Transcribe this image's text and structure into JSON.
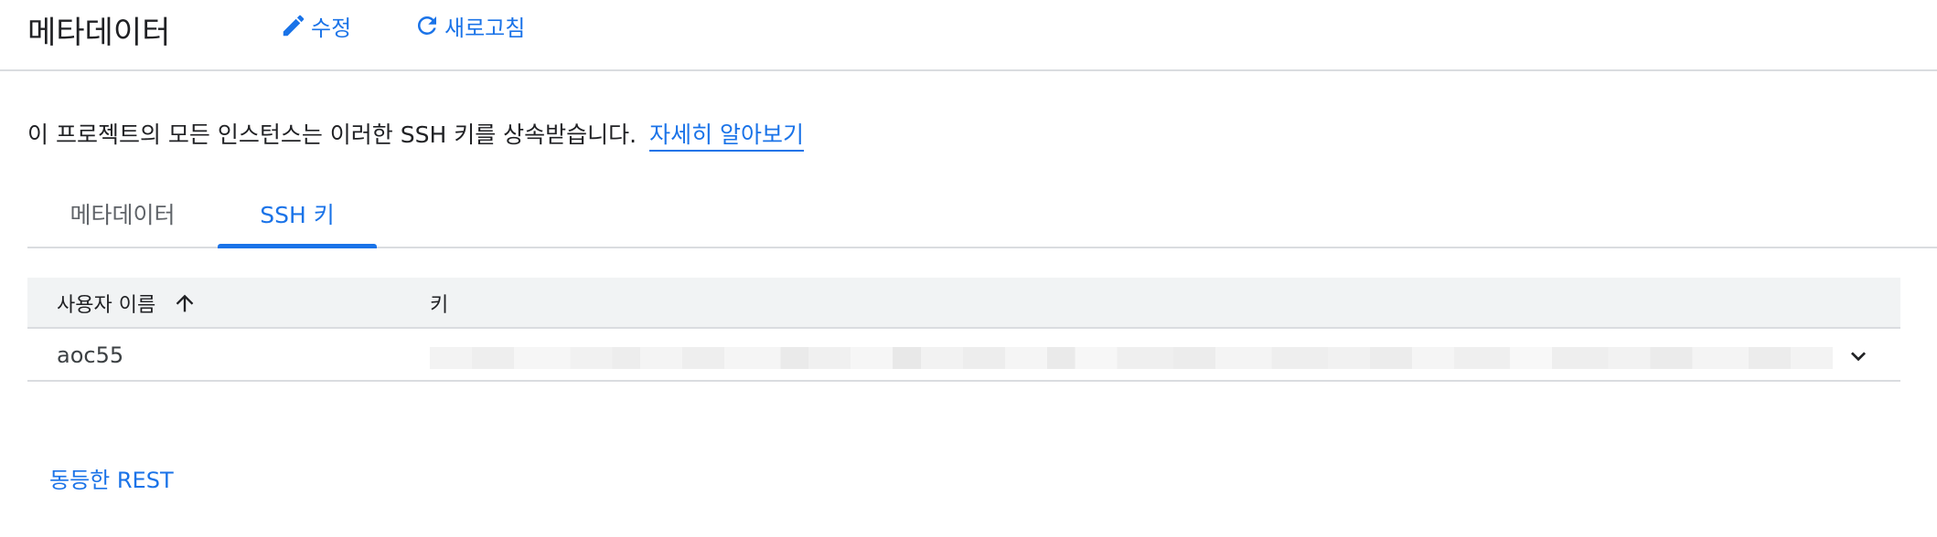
{
  "header": {
    "title": "메타데이터",
    "edit_label": "수정",
    "refresh_label": "새로고침"
  },
  "description": {
    "text": "이 프로젝트의 모든 인스턴스는 이러한 SSH 키를 상속받습니다.",
    "learn_more": "자세히 알아보기"
  },
  "tabs": [
    {
      "label": "메타데이터",
      "active": false
    },
    {
      "label": "SSH 키",
      "active": true
    }
  ],
  "table": {
    "columns": [
      "사용자 이름",
      "키"
    ],
    "sort_column": "사용자 이름",
    "sort_direction": "ascending",
    "rows": [
      {
        "username": "aoc55",
        "key_redacted": true
      }
    ]
  },
  "footer": {
    "equivalent_rest": "동등한 REST"
  },
  "colors": {
    "accent": "#1a73e8",
    "divider": "#dadce0",
    "header_bg": "#f1f3f4"
  },
  "icons": [
    "edit-icon",
    "refresh-icon",
    "sort-up-arrow-icon",
    "chevron-down-icon"
  ]
}
